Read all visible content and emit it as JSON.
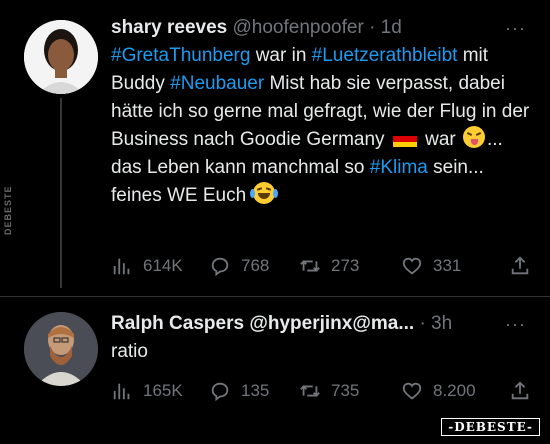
{
  "tweets": [
    {
      "author_name": "shary reeves",
      "handle": "@hoofenpoofer",
      "separator": "·",
      "time": "1d",
      "more_label": "···",
      "text_runs": {
        "t1": "#GretaThunberg",
        "t2": " war in ",
        "t3": "#Luetzerathbleibt",
        "t4": " mit Buddy ",
        "t5": "#Neubauer",
        "t6": " Mist hab sie verpasst, dabei hätte ich so gerne mal gefragt, wie der Flug in der Business nach Goodie Germany ",
        "t7": " war ",
        "t8": "... das Leben kann manchmal so ",
        "t9": "#Klima",
        "t10": " sein... feines WE Euch "
      },
      "emoji": [
        "flag-germany",
        "squinting-tongue-face",
        "tears-of-joy-face"
      ],
      "stats": {
        "views": "614K",
        "replies": "768",
        "retweets": "273",
        "likes": "331"
      }
    },
    {
      "author_name": "Ralph Caspers",
      "handle": "@hyperjinx@ma...",
      "separator": "·",
      "time": "3h",
      "more_label": "···",
      "text": "ratio",
      "stats": {
        "views": "165K",
        "replies": "135",
        "retweets": "735",
        "likes": "8.200"
      }
    }
  ],
  "icons": {
    "views": "bar-chart-icon",
    "reply": "speech-bubble-icon",
    "retweet": "retweet-arrows-icon",
    "like": "heart-icon",
    "share": "share-upload-icon"
  },
  "colors": {
    "background": "#000000",
    "text": "#e7e9ea",
    "muted": "#71767b",
    "link": "#1d9bf0",
    "divider": "#2f3336"
  },
  "watermarks": {
    "side": "DEBESTE",
    "corner": "-DEBESTE-"
  }
}
